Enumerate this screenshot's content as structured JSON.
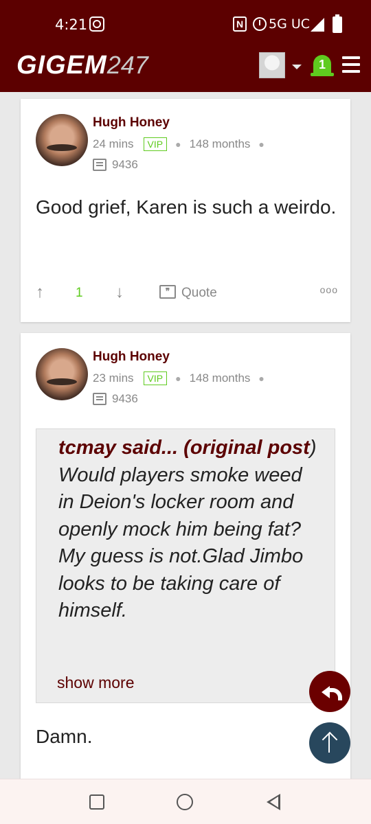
{
  "status_bar": {
    "time": "4:21",
    "network": "5G UC",
    "nfc": "N"
  },
  "header": {
    "logo_text": "GIGEM",
    "logo_number": "247",
    "notification_count": "1"
  },
  "posts": [
    {
      "username": "Hugh Honey",
      "time": "24 mins",
      "badge": "VIP",
      "tenure": "148 months",
      "post_count": "9436",
      "body": "Good grief, Karen is such a weirdo.",
      "score": "1",
      "quote_label": "Quote"
    },
    {
      "username": "Hugh Honey",
      "time": "23 mins",
      "badge": "VIP",
      "tenure": "148 months",
      "post_count": "9436",
      "quote": {
        "author": "tcmay said... (",
        "link": "original post",
        "close": ")",
        "text": " Would players smoke weed in Deion's locker room and openly mock him being fat? My guess is not.Glad Jimbo looks to be taking care of himself.",
        "show_more": "show more"
      },
      "body": "Damn."
    }
  ],
  "colors": {
    "brand": "#5c0000",
    "accent_green": "#5fcb1f",
    "fab_top": "#28475d"
  }
}
